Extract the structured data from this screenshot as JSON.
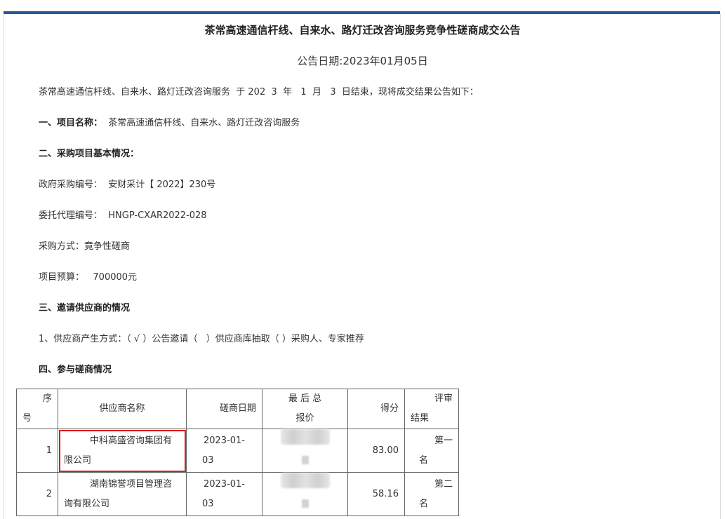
{
  "document": {
    "title": "茶常高速通信杆线、自来水、路灯迁改咨询服务竞争性磋商成交公告",
    "date_label": "公告日期:2023年01月05日",
    "intro": "茶常高速通信杆线、自来水、路灯迁改咨询服务  于 202  3  年   1  月   3  日结束，现将成交结果公告如下：",
    "section1_heading": "一、项目名称：",
    "section1_value": "  茶常高速通信杆线、自来水、路灯迁改咨询服务",
    "section2_heading": "二、采购项目基本情况：",
    "gov_code": "政府采购编号：  安财采计【 2022】230号",
    "agent_code": "委托代理编号：  HNGP-CXAR2022-028",
    "method": "采购方式：竟争性磋商",
    "budget": "项目预算：   700000元",
    "section3_heading": "三、邀请供应商的情况",
    "supplier_method": "1、供应商产生方式：（ √ ）公告邀请（   ）供应商库抽取（ ）采购人、专家推荐",
    "section4_heading": "四、参与磋商情况"
  },
  "table": {
    "headers": {
      "index_line1": "序",
      "index_line2": "号",
      "supplier": "供应商名称",
      "date": "磋商日期",
      "price_line1": "最 后 总",
      "price_line2": "报价",
      "score": "得分",
      "result_line1": "评审",
      "result_line2": "结果"
    },
    "rows": [
      {
        "index": "1",
        "supplier_line1": "中科高盛咨询集团有",
        "supplier_line2": "限公司",
        "date_line1": "2023-01-",
        "date_line2": "03",
        "score": "83.00",
        "result_line1": "第一",
        "result_line2": "名"
      },
      {
        "index": "2",
        "supplier_line1": "湖南锦誉项目管理咨",
        "supplier_line2": "询有限公司",
        "date_line1": "2023-01-",
        "date_line2": "03",
        "score": "58.16",
        "result_line1": "第二",
        "result_line2": "名"
      }
    ]
  },
  "colors": {
    "topbar": "#2e5797",
    "highlight": "#e01a1a"
  }
}
